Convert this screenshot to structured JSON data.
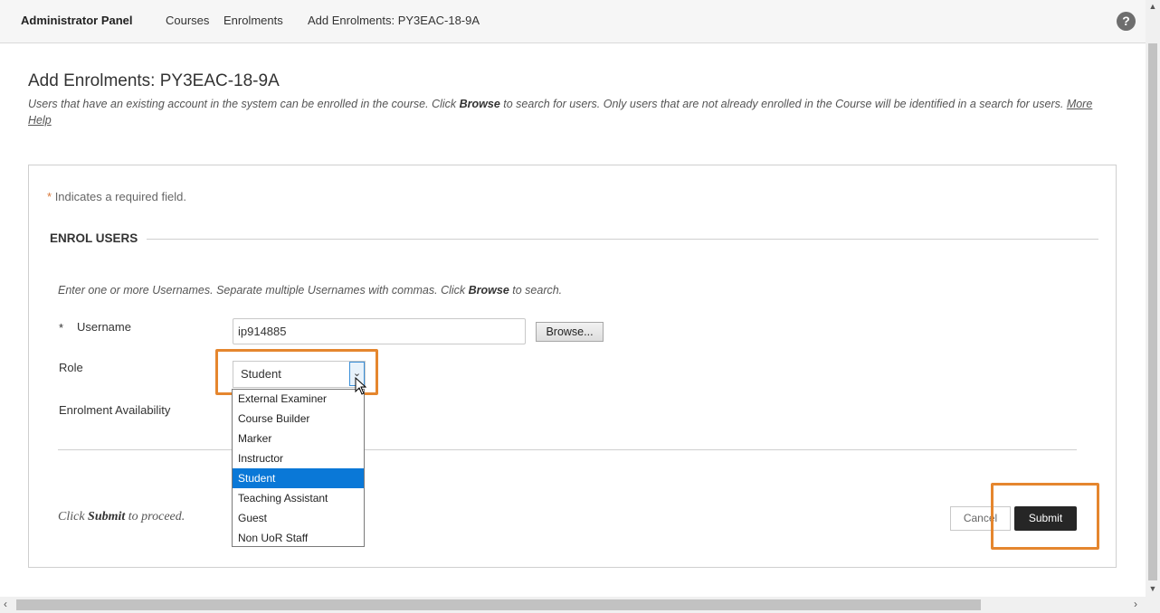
{
  "nav": {
    "brand": "Administrator Panel",
    "items": [
      "Courses",
      "Enrolments",
      "Add Enrolments: PY3EAC-18-9A"
    ],
    "help_icon": "?"
  },
  "page": {
    "title": "Add Enrolments: PY3EAC-18-9A",
    "desc_part1": "Users that have an existing account in the system can be enrolled in the course. Click ",
    "desc_bold": "Browse",
    "desc_part2": " to search for users. Only users that are not already enrolled in the Course will be identified in a search for users. ",
    "more_help": "More Help"
  },
  "form": {
    "required_star": "*",
    "required_note": "Indicates a required field.",
    "section_title": "ENROL USERS",
    "instr_part1": "Enter one or more Usernames. Separate multiple Usernames with commas. Click ",
    "instr_bold": "Browse",
    "instr_part2": " to search.",
    "username_label": "Username",
    "username_value": "ip914885",
    "browse_label": "Browse...",
    "role_label": "Role",
    "role_value": "Student",
    "role_options": [
      "External Examiner",
      "Course Builder",
      "Marker",
      "Instructor",
      "Student",
      "Teaching Assistant",
      "Guest",
      "Non UoR Staff"
    ],
    "role_selected_index": 4,
    "availability_label": "Enrolment Availability",
    "proceed_part1": "Click ",
    "proceed_bold": "Submit",
    "proceed_part2": " to proceed.",
    "cancel_label": "Cancel",
    "submit_label": "Submit"
  },
  "colors": {
    "highlight": "#e5862e",
    "selected_option": "#0a78d7",
    "submit_bg": "#262626",
    "required_star": "#d9783a"
  }
}
